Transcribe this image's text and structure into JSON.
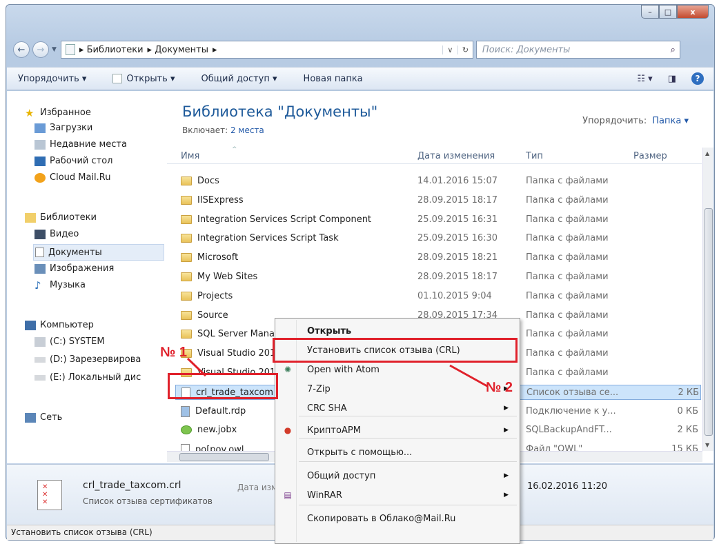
{
  "window": {
    "min_label": "–",
    "max_label": "□",
    "close_label": "x"
  },
  "address": {
    "back_label": "←",
    "forward_label": "→",
    "crumbs": [
      "▸ Библиотеки",
      "▸ Документы",
      "▸"
    ],
    "search_placeholder": "Поиск: Документы"
  },
  "toolbar": {
    "organize": "Упорядочить ▾",
    "open": "Открыть ▾",
    "share": "Общий доступ ▾",
    "new_folder": "Новая папка"
  },
  "nav": {
    "favorites": "Избранное",
    "downloads": "Загрузки",
    "recent": "Недавние места",
    "desktop": "Рабочий стол",
    "cloud": "Cloud Mail.Ru",
    "libraries": "Библиотеки",
    "video": "Видео",
    "documents": "Документы",
    "images": "Изображения",
    "music": "Музыка",
    "computer": "Компьютер",
    "drive_c": "(C:) SYSTEM",
    "drive_d": "(D:) Зарезервирова",
    "drive_e": "(E:) Локальный дис",
    "network": "Сеть"
  },
  "library": {
    "title": "Библиотека \"Документы\"",
    "includes_label": "Включает: ",
    "includes_link": "2 места",
    "arrange_label": "Упорядочить:",
    "arrange_value": "Папка ▾"
  },
  "columns": {
    "name": "Имя",
    "date": "Дата изменения",
    "type": "Тип",
    "size": "Размер"
  },
  "files": [
    {
      "name": "Docs",
      "date": "14.01.2016 15:07",
      "type": "Папка с файлами",
      "size": "",
      "kind": "folder"
    },
    {
      "name": "IISExpress",
      "date": "28.09.2015 18:17",
      "type": "Папка с файлами",
      "size": "",
      "kind": "folder"
    },
    {
      "name": "Integration Services Script Component",
      "date": "25.09.2015 16:31",
      "type": "Папка с файлами",
      "size": "",
      "kind": "folder"
    },
    {
      "name": "Integration Services Script Task",
      "date": "25.09.2015 16:30",
      "type": "Папка с файлами",
      "size": "",
      "kind": "folder"
    },
    {
      "name": "Microsoft",
      "date": "28.09.2015 18:21",
      "type": "Папка с файлами",
      "size": "",
      "kind": "folder"
    },
    {
      "name": "My Web Sites",
      "date": "28.09.2015 18:17",
      "type": "Папка с файлами",
      "size": "",
      "kind": "folder"
    },
    {
      "name": "Projects",
      "date": "01.10.2015 9:04",
      "type": "Папка с файлами",
      "size": "",
      "kind": "folder"
    },
    {
      "name": "Source",
      "date": "28.09.2015 17:34",
      "type": "Папка с файлами",
      "size": "",
      "kind": "folder"
    },
    {
      "name": "SQL Server Mana",
      "date": "",
      "type": "Папка с файлами",
      "size": "",
      "kind": "folder"
    },
    {
      "name": "Visual Studio 201",
      "date": "",
      "type": "Папка с файлами",
      "size": "",
      "kind": "folder"
    },
    {
      "name": "Visual Studio 201",
      "date": "",
      "type": "Папка с файлами",
      "size": "",
      "kind": "folder"
    },
    {
      "name": "crl_trade_taxcom",
      "date": "",
      "type": "Список отзыва се...",
      "size": "2 КБ",
      "kind": "crl"
    },
    {
      "name": "Default.rdp",
      "date": "",
      "type": "Подключение к у...",
      "size": "0 КБ",
      "kind": "rdp"
    },
    {
      "name": "new.jobx",
      "date": "",
      "type": "SQLBackupAndFT...",
      "size": "2 КБ",
      "kind": "jobx"
    },
    {
      "name": "po[pov.owl",
      "date": "",
      "type": "Файл \"OWL\"",
      "size": "15 КБ",
      "kind": "file"
    }
  ],
  "context_menu": [
    {
      "label": "Открыть",
      "bold": true,
      "submenu": false,
      "icon": ""
    },
    {
      "label": "Установить список отзыва (CRL)",
      "bold": false,
      "submenu": false,
      "icon": ""
    },
    {
      "label": "Open with Atom",
      "bold": false,
      "submenu": false,
      "icon": "atom-icon"
    },
    {
      "label": "7-Zip",
      "bold": false,
      "submenu": true,
      "icon": ""
    },
    {
      "label": "CRC SHA",
      "bold": false,
      "submenu": true,
      "icon": ""
    },
    {
      "label": "КриптоАРМ",
      "bold": false,
      "submenu": true,
      "icon": "cryptoarm-icon"
    },
    {
      "label": "Открыть с помощью...",
      "bold": false,
      "submenu": false,
      "icon": ""
    },
    {
      "label": "Общий доступ",
      "bold": false,
      "submenu": true,
      "icon": ""
    },
    {
      "label": "WinRAR",
      "bold": false,
      "submenu": true,
      "icon": "winrar-icon"
    },
    {
      "label": "Скопировать в Облако@Mail.Ru",
      "bold": false,
      "submenu": false,
      "icon": ""
    }
  ],
  "annotations": {
    "step1": "№ 1",
    "step2": "№ 2",
    "color": "#e0212b"
  },
  "details": {
    "filename": "crl_trade_taxcom.crl",
    "filetype": "Список отзыва сертификатов",
    "modified_label": "Дата изм",
    "modified_value": "16.02.2016 11:20"
  },
  "status_text": "Установить список отзыва (CRL)"
}
